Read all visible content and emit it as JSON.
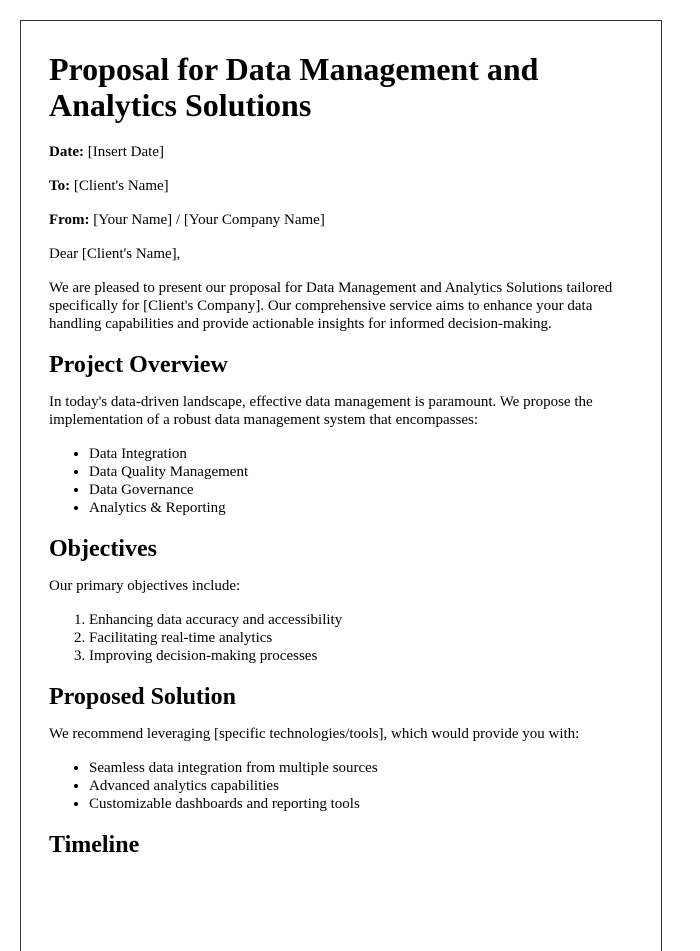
{
  "document": {
    "title": "Proposal for Data Management and Analytics Solutions",
    "meta": [
      {
        "label": "Date:",
        "value": "[Insert Date]"
      },
      {
        "label": "To:",
        "value": "[Client's Name]"
      },
      {
        "label": "From:",
        "value": "[Your Name] / [Your Company Name]"
      }
    ],
    "salutation": "Dear [Client's Name],",
    "intro": "We are pleased to present our proposal for Data Management and Analytics Solutions tailored specifically for [Client's Company]. Our comprehensive service aims to enhance your data handling capabilities and provide actionable insights for informed decision-making.",
    "sections": {
      "overview": {
        "heading": "Project Overview",
        "text": "In today's data-driven landscape, effective data management is paramount. We propose the implementation of a robust data management system that encompasses:",
        "items": [
          "Data Integration",
          "Data Quality Management",
          "Data Governance",
          "Analytics & Reporting"
        ]
      },
      "objectives": {
        "heading": "Objectives",
        "text": "Our primary objectives include:",
        "items": [
          "Enhancing data accuracy and accessibility",
          "Facilitating real-time analytics",
          "Improving decision-making processes"
        ]
      },
      "solution": {
        "heading": "Proposed Solution",
        "text": "We recommend leveraging [specific technologies/tools], which would provide you with:",
        "items": [
          "Seamless data integration from multiple sources",
          "Advanced analytics capabilities",
          "Customizable dashboards and reporting tools"
        ]
      },
      "timeline": {
        "heading": "Timeline"
      }
    }
  }
}
